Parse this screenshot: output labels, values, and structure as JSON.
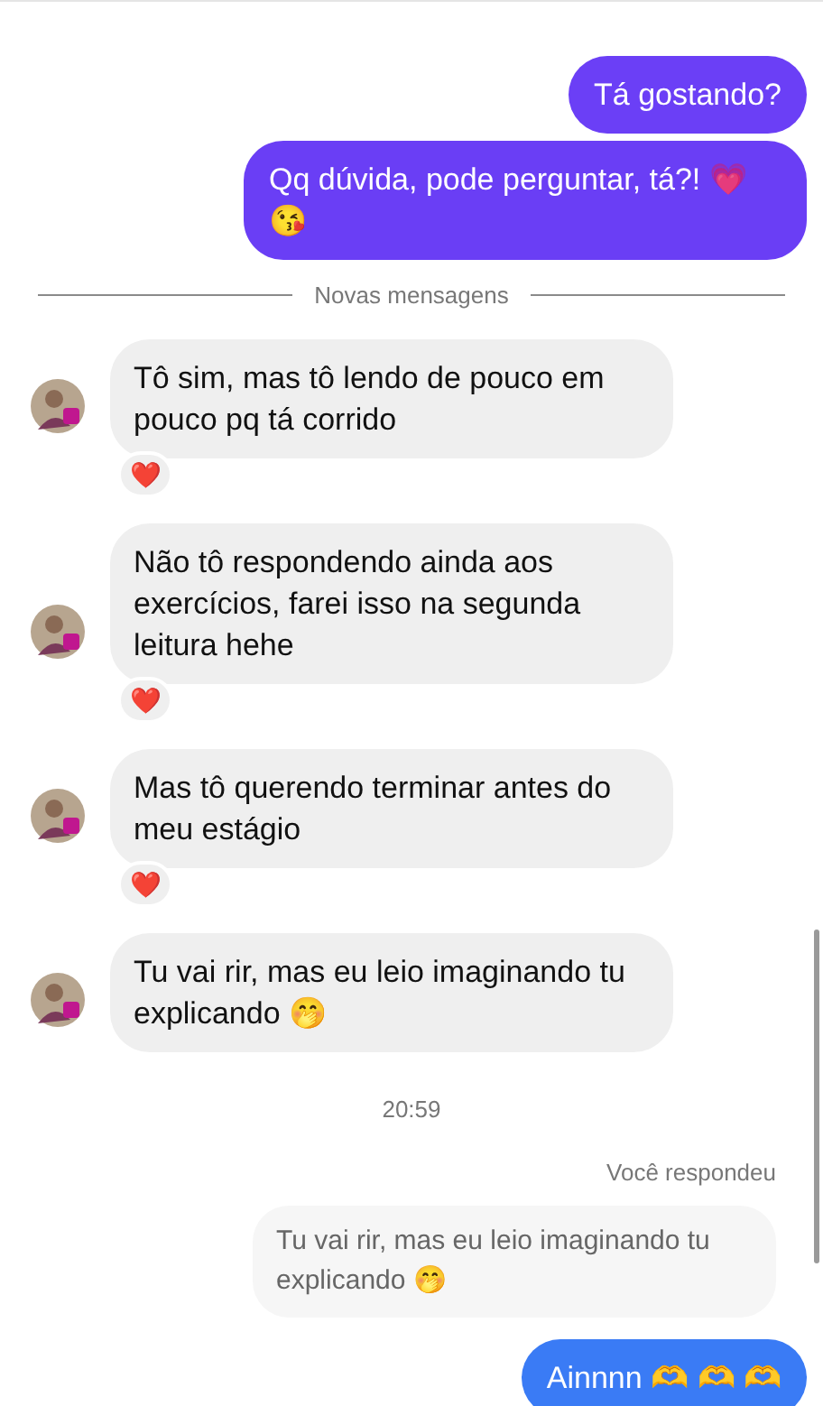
{
  "messages": [
    {
      "kind": "sent",
      "text": "Tá gostando?",
      "color": "#6b3ff6"
    },
    {
      "kind": "sent",
      "text": "Qq dúvida, pode perguntar, tá?! 💗 😘",
      "color": "#6a3ef5"
    },
    {
      "kind": "divider",
      "text": "Novas mensagens"
    },
    {
      "kind": "received",
      "text": "Tô sim, mas tô lendo de pouco em pouco pq tá corrido",
      "reaction": "❤️"
    },
    {
      "kind": "received",
      "text": "Não tô respondendo ainda aos exercícios, farei isso na segunda leitura hehe",
      "reaction": "❤️"
    },
    {
      "kind": "received",
      "text": "Mas tô querendo terminar antes do meu estágio",
      "reaction": "❤️"
    },
    {
      "kind": "received",
      "text": "Tu vai rir, mas eu leio imaginando tu explicando 🤭"
    },
    {
      "kind": "time",
      "text": "20:59"
    },
    {
      "kind": "reply_label",
      "text": "Você respondeu"
    },
    {
      "kind": "quote",
      "text": "Tu vai rir, mas eu leio imaginando tu explicando 🤭"
    },
    {
      "kind": "sent",
      "text": "Ainnnn 🫶 🫶 🫶",
      "color": "#3a7bf5"
    }
  ]
}
